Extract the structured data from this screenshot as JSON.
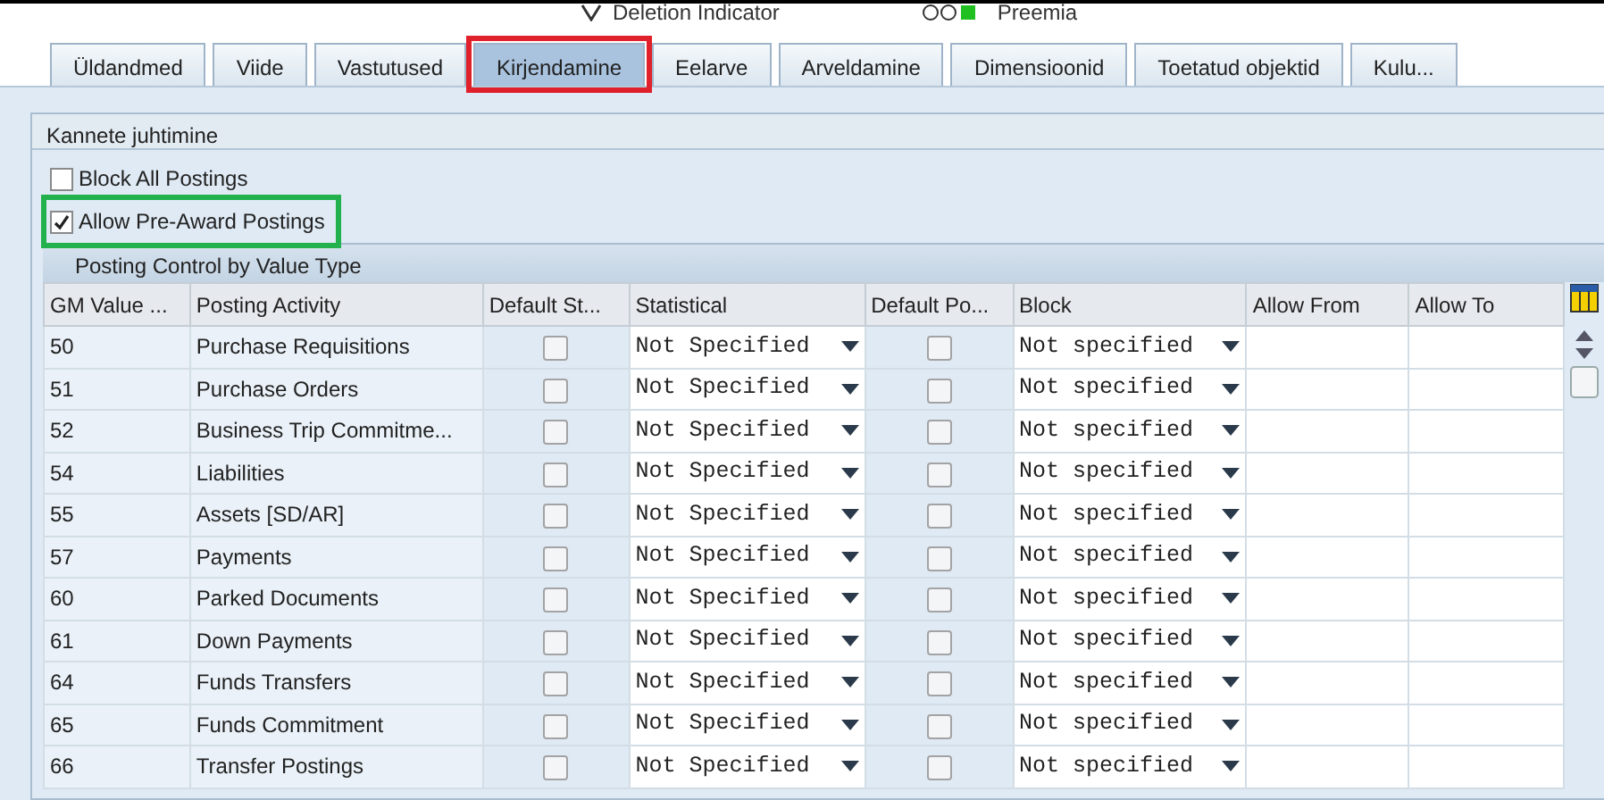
{
  "top_fields": [
    {
      "kind": "deletion",
      "label": "Deletion Indicator"
    },
    {
      "kind": "lights",
      "label": "Preemia"
    }
  ],
  "tabs": [
    {
      "label": "Üldandmed",
      "selected": false,
      "outlined": false
    },
    {
      "label": "Viide",
      "selected": false,
      "outlined": false
    },
    {
      "label": "Vastutused",
      "selected": false,
      "outlined": false
    },
    {
      "label": "Kirjendamine",
      "selected": true,
      "outlined": true
    },
    {
      "label": "Eelarve",
      "selected": false,
      "outlined": false
    },
    {
      "label": "Arveldamine",
      "selected": false,
      "outlined": false
    },
    {
      "label": "Dimensioonid",
      "selected": false,
      "outlined": false
    },
    {
      "label": "Toetatud objektid",
      "selected": false,
      "outlined": false
    },
    {
      "label": "Kulu...",
      "selected": false,
      "outlined": false
    }
  ],
  "group": {
    "title": "Kannete juhtimine",
    "checkboxes": [
      {
        "label": "Block All Postings",
        "checked": false,
        "outlined": false
      },
      {
        "label": "Allow Pre-Award Postings",
        "checked": true,
        "outlined": true
      }
    ],
    "table": {
      "title": "Posting Control by Value Type",
      "columns": [
        "GM Value ...",
        "Posting Activity",
        "Default St...",
        "Statistical",
        "Default Po...",
        "Block",
        "Allow From",
        "Allow To"
      ],
      "rows": [
        {
          "value_type": "50",
          "activity": "Purchase Requisitions",
          "default_st": false,
          "statistical": "Not Specified",
          "default_po": false,
          "block": "Not specified"
        },
        {
          "value_type": "51",
          "activity": "Purchase Orders",
          "default_st": false,
          "statistical": "Not Specified",
          "default_po": false,
          "block": "Not specified"
        },
        {
          "value_type": "52",
          "activity": "Business Trip Commitme...",
          "default_st": false,
          "statistical": "Not Specified",
          "default_po": false,
          "block": "Not specified"
        },
        {
          "value_type": "54",
          "activity": "Liabilities",
          "default_st": false,
          "statistical": "Not Specified",
          "default_po": false,
          "block": "Not specified"
        },
        {
          "value_type": "55",
          "activity": "Assets [SD/AR]",
          "default_st": false,
          "statistical": "Not Specified",
          "default_po": false,
          "block": "Not specified"
        },
        {
          "value_type": "57",
          "activity": "Payments",
          "default_st": false,
          "statistical": "Not Specified",
          "default_po": false,
          "block": "Not specified"
        },
        {
          "value_type": "60",
          "activity": "Parked Documents",
          "default_st": false,
          "statistical": "Not Specified",
          "default_po": false,
          "block": "Not specified"
        },
        {
          "value_type": "61",
          "activity": "Down Payments",
          "default_st": false,
          "statistical": "Not Specified",
          "default_po": false,
          "block": "Not specified"
        },
        {
          "value_type": "64",
          "activity": "Funds Transfers",
          "default_st": false,
          "statistical": "Not Specified",
          "default_po": false,
          "block": "Not specified"
        },
        {
          "value_type": "65",
          "activity": "Funds Commitment",
          "default_st": false,
          "statistical": "Not Specified",
          "default_po": false,
          "block": "Not specified"
        },
        {
          "value_type": "66",
          "activity": "Transfer Postings",
          "default_st": false,
          "statistical": "Not Specified",
          "default_po": false,
          "block": "Not specified"
        }
      ]
    }
  }
}
